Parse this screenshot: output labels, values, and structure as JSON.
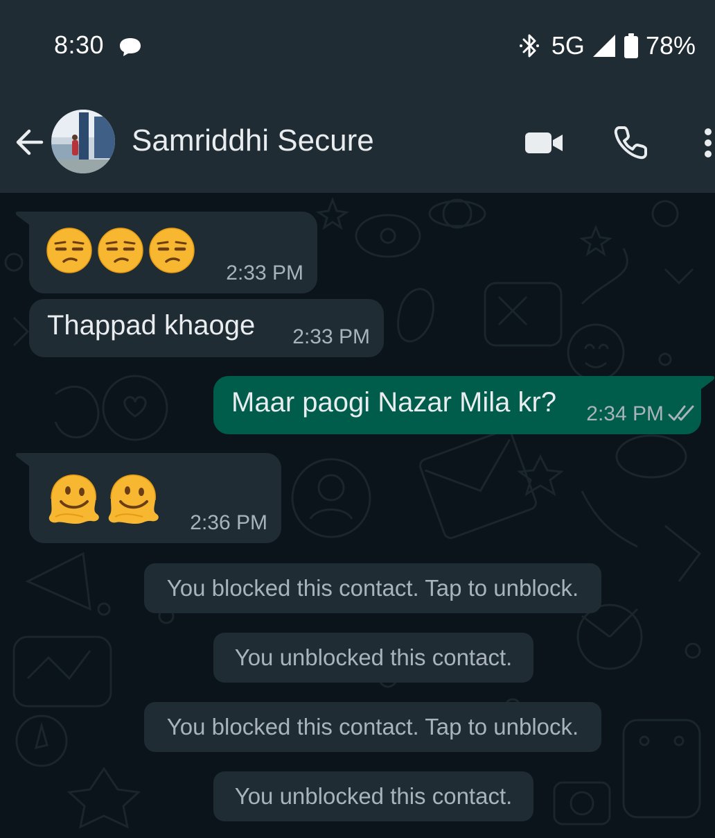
{
  "status_bar": {
    "time": "8:30",
    "network": "5G",
    "battery": "78%"
  },
  "header": {
    "contact_name": "Samriddhi Secure"
  },
  "messages": [
    {
      "direction": "incoming",
      "emojis": [
        "unamused-face",
        "unamused-face",
        "unamused-face"
      ],
      "time": "2:33 PM"
    },
    {
      "direction": "incoming",
      "text": "Thappad khaoge",
      "time": "2:33 PM"
    },
    {
      "direction": "outgoing",
      "text": "Maar paogi Nazar Mila kr?",
      "time": "2:34 PM",
      "status": "read"
    },
    {
      "direction": "incoming",
      "emojis": [
        "melting-face",
        "melting-face"
      ],
      "time": "2:36 PM"
    }
  ],
  "system_messages": [
    "You blocked this contact. Tap to unblock.",
    "You unblocked this contact.",
    "You blocked this contact. Tap to unblock.",
    "You unblocked this contact."
  ],
  "colors": {
    "bar_background": "#1f2c34",
    "chat_background": "#0b141a",
    "incoming_bubble": "#1f2c34",
    "outgoing_bubble": "#005c4b",
    "primary_text": "#e9edef",
    "secondary_text": "#a9b4ba"
  }
}
